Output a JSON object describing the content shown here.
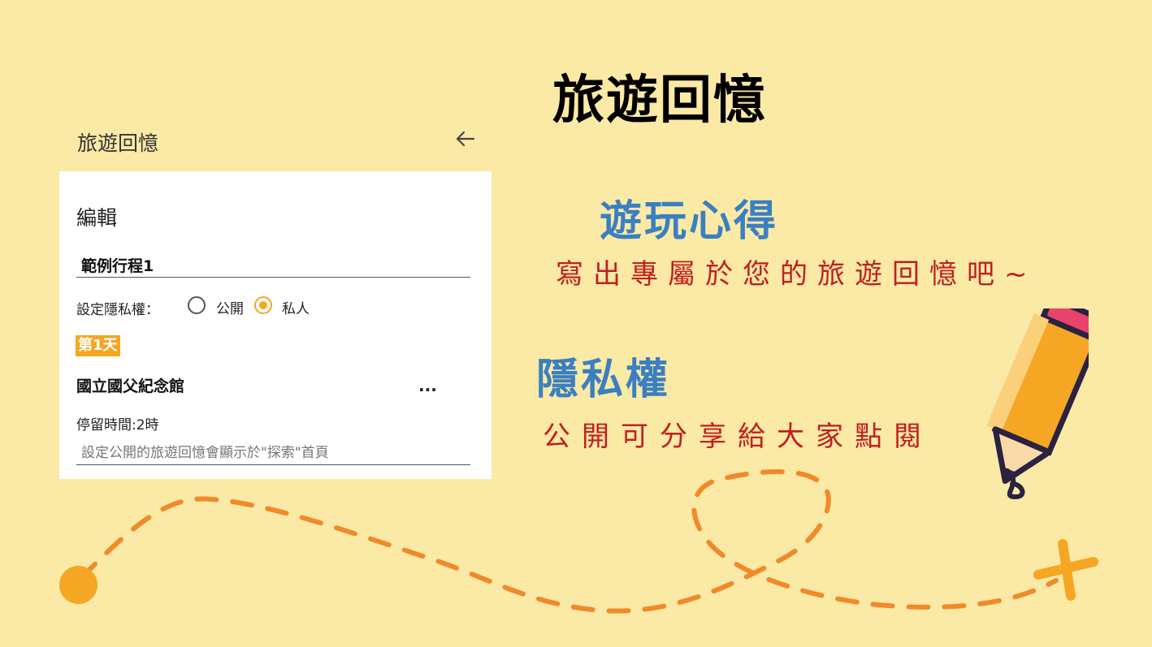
{
  "app": {
    "title": "旅遊回憶",
    "back_icon": "arrow-left-icon"
  },
  "card": {
    "heading": "編輯",
    "trip_name": "範例行程1",
    "privacy_label": "設定隱私權：",
    "privacy_options": [
      {
        "label": "公開",
        "selected": false
      },
      {
        "label": "私人",
        "selected": true
      }
    ],
    "day_badge": "第1天",
    "place_name": "國立國父紀念館",
    "more_icon": "more-horizontal-icon",
    "more_glyph": "...",
    "stay_time": "停留時間:2時",
    "note_placeholder": "設定公開的旅遊回憶會顯示於\"探索\"首頁"
  },
  "slide": {
    "title": "旅遊回憶",
    "section1_heading": "遊玩心得",
    "section1_desc": "寫出專屬於您的旅遊回憶吧~",
    "section2_heading": "隱私權",
    "section2_desc": "公開可分享給大家點閱"
  },
  "colors": {
    "background": "#fbe9a6",
    "accent": "#f5a623",
    "heading_blue": "#3a7fc1",
    "desc_red": "#c0201f",
    "dashed_path": "#f08a2a"
  },
  "decor": {
    "pencil_icon": "pencil-icon",
    "start_dot": "start-dot",
    "end_cross": "cross-mark-icon"
  }
}
